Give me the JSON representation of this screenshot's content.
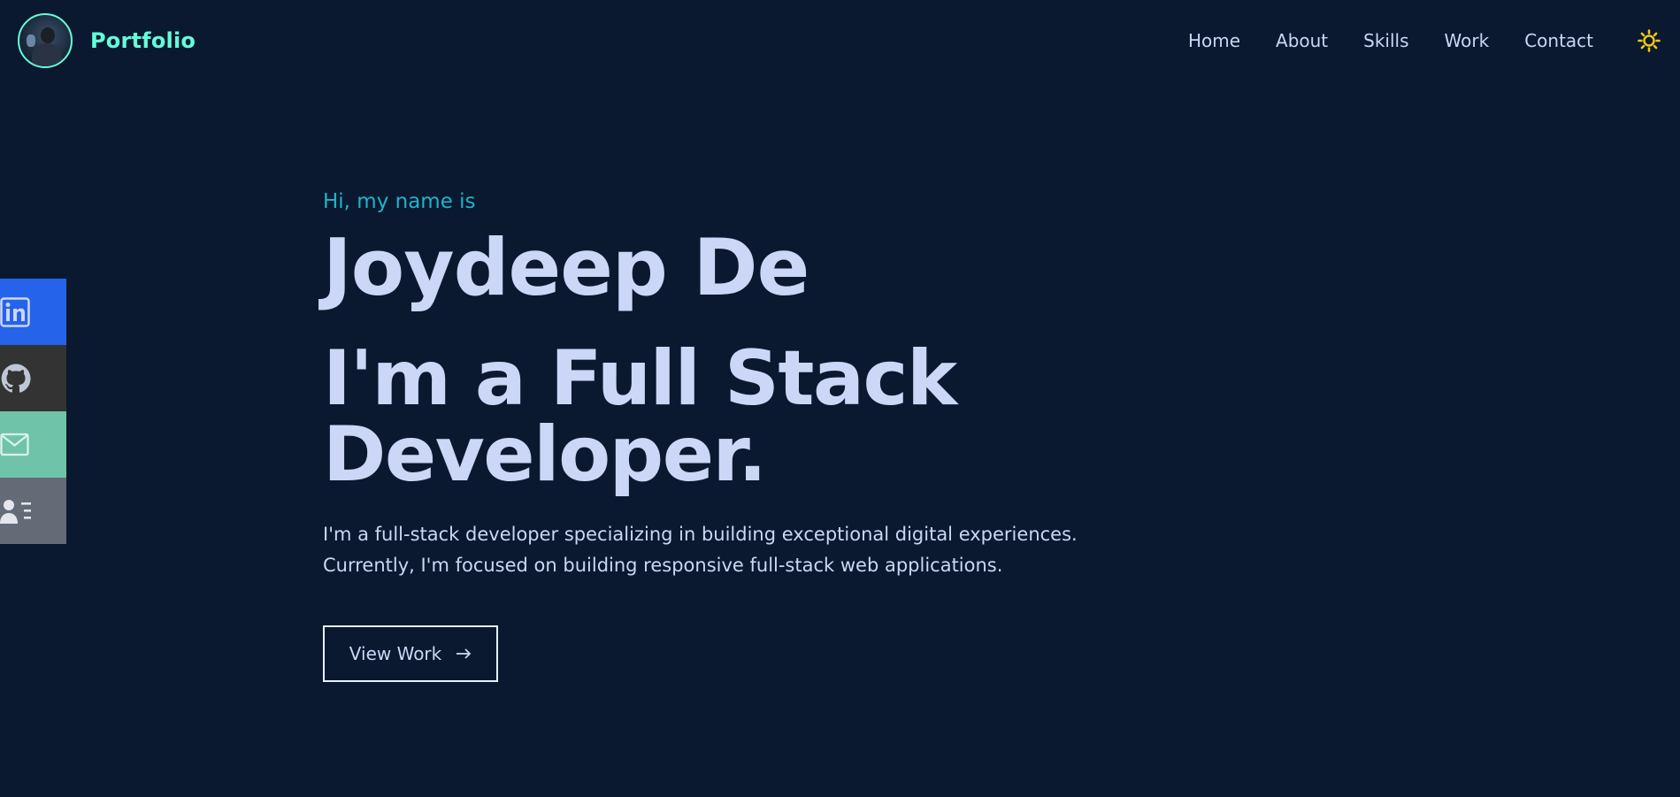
{
  "brand": {
    "name": "Portfolio"
  },
  "nav": {
    "items": [
      "Home",
      "About",
      "Skills",
      "Work",
      "Contact"
    ],
    "theme_toggle_icon": "sun-icon"
  },
  "social": {
    "items": [
      {
        "name": "linkedin",
        "icon": "linkedin-icon",
        "color": "#2563eb"
      },
      {
        "name": "github",
        "icon": "github-icon",
        "color": "#333333"
      },
      {
        "name": "email",
        "icon": "mail-icon",
        "color": "#6fc3a9"
      },
      {
        "name": "resume",
        "icon": "contact-card-icon",
        "color": "#636b76"
      }
    ]
  },
  "hero": {
    "greeting": "Hi, my name is",
    "name": "Joydeep De",
    "role": "I'm a Full Stack Developer.",
    "desc_line1": "I'm a full-stack developer specializing in building exceptional digital experiences.",
    "desc_line2": "Currently, I'm focused on building responsive full-stack web applications.",
    "cta_label": "View Work",
    "cta_icon": "arrow-right-icon"
  },
  "colors": {
    "background": "#0a192f",
    "accent": "#64ffda",
    "greeting": "#22b3c9",
    "text": "#ccd6f6",
    "sun": "#f5c518"
  }
}
